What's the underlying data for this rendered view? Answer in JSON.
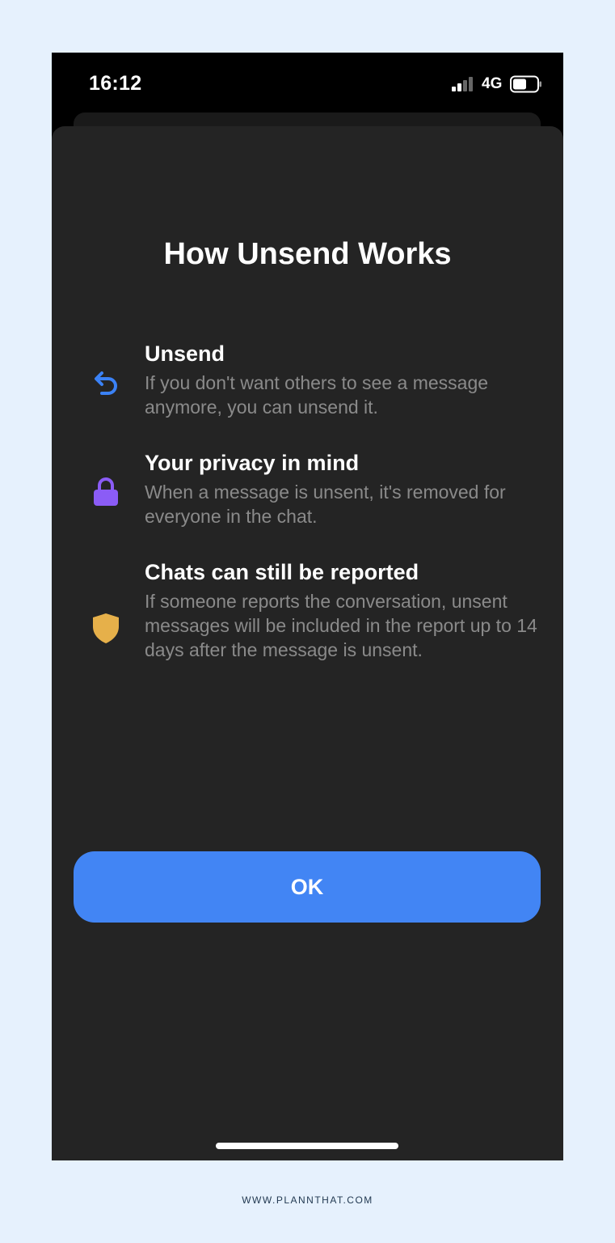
{
  "status_bar": {
    "time": "16:12",
    "network": "4G",
    "signal_strength_bars": 2,
    "signal_total_bars": 4,
    "battery_level": 0.5
  },
  "sheet": {
    "title": "How Unsend Works",
    "features": [
      {
        "icon": "undo-arrow-icon",
        "icon_color": "#3b82f6",
        "heading": "Unsend",
        "description": "If you don't want others to see a message anymore, you can unsend it."
      },
      {
        "icon": "lock-icon",
        "icon_color": "#8b5cf6",
        "heading": "Your privacy in mind",
        "description": "When a message is unsent, it's removed for everyone in the chat."
      },
      {
        "icon": "shield-icon",
        "icon_color": "#e6b04a",
        "heading": "Chats can still be reported",
        "description": "If someone reports the conversation, unsent messages will be included in the report up to 14 days after the message is unsent."
      }
    ],
    "ok_label": "OK"
  },
  "footer": {
    "credit": "WWW.PLANNTHAT.COM"
  },
  "colors": {
    "page_background": "#e6f1fd",
    "sheet_background": "#242424",
    "primary_button": "#4285f4",
    "secondary_text": "#8a8a8a"
  }
}
